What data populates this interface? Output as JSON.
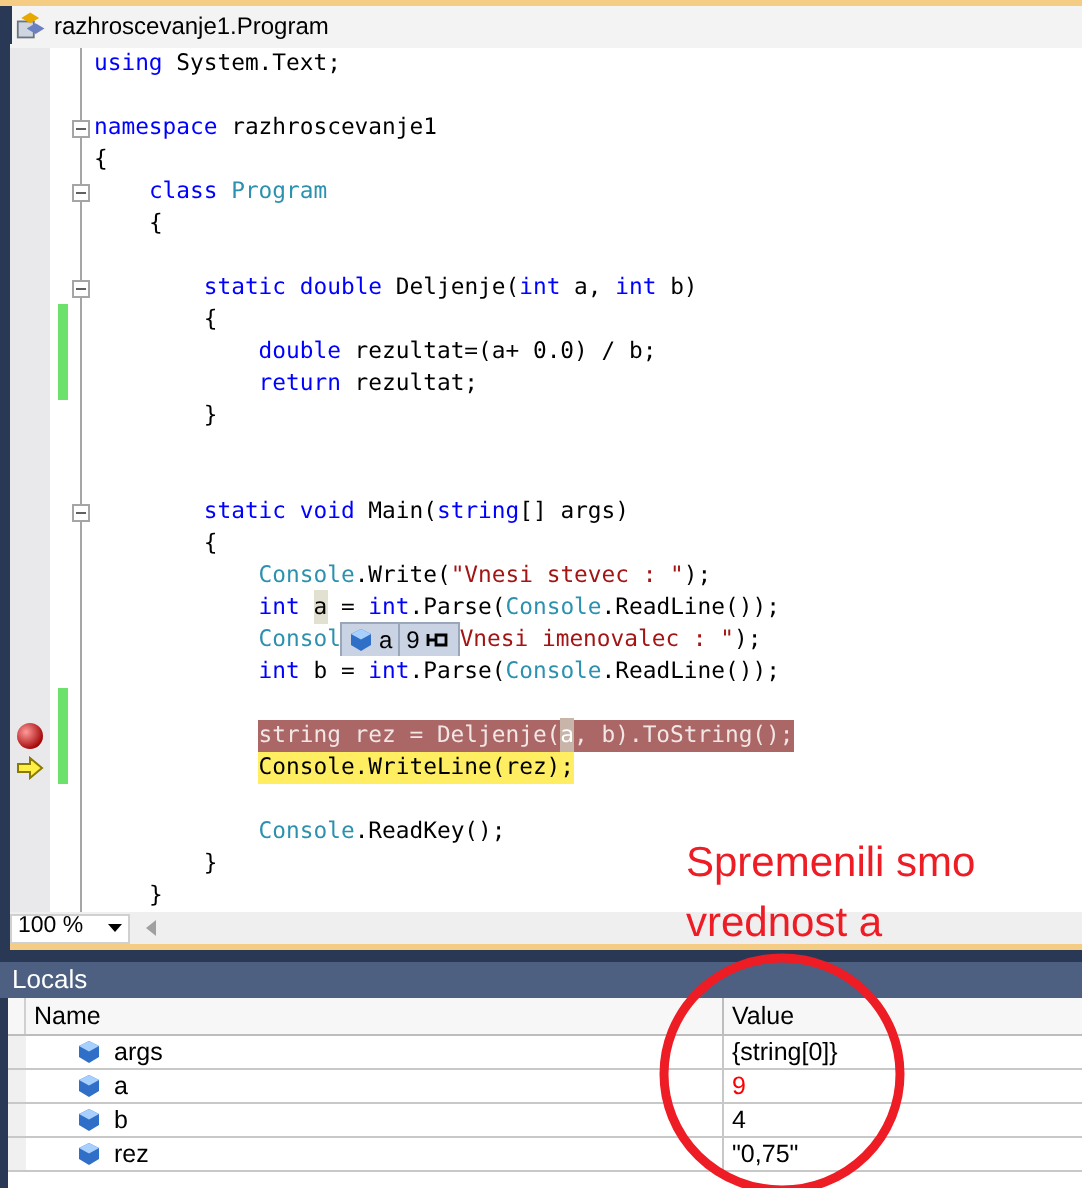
{
  "document_tab": {
    "title": "razhroscevanje1.Program"
  },
  "code_lines": [
    {
      "tokens": [
        {
          "text": "using",
          "kind": "keyword"
        },
        {
          "text": " System.Text;",
          "kind": "plain"
        }
      ],
      "fold": false,
      "modified": false,
      "breakpoint": false,
      "current": false
    },
    {
      "fold": false,
      "modified": false,
      "breakpoint": false,
      "current": false
    },
    {
      "tokens": [
        {
          "text": "namespace",
          "kind": "keyword"
        },
        {
          "text": " razhroscevanje1",
          "kind": "plain"
        }
      ],
      "fold": true,
      "modified": false,
      "breakpoint": false,
      "current": false
    },
    {
      "tokens": [
        {
          "text": "{",
          "kind": "plain"
        }
      ],
      "fold": false,
      "modified": false,
      "breakpoint": false,
      "current": false
    },
    {
      "tokens": [
        {
          "text": "    class",
          "kind": "keyword"
        },
        {
          "text": " Program",
          "kind": "type"
        }
      ],
      "fold": true,
      "modified": false,
      "breakpoint": false,
      "current": false
    },
    {
      "tokens": [
        {
          "text": "    {",
          "kind": "plain"
        }
      ],
      "fold": false,
      "modified": false,
      "breakpoint": false,
      "current": false
    },
    {
      "fold": false,
      "modified": false,
      "breakpoint": false,
      "current": false
    },
    {
      "tokens": [
        {
          "text": "        static",
          "kind": "keyword"
        },
        {
          "text": " double",
          "kind": "keyword"
        },
        {
          "text": " Deljenje(",
          "kind": "plain"
        },
        {
          "text": "int",
          "kind": "keyword"
        },
        {
          "text": " a, ",
          "kind": "plain"
        },
        {
          "text": "int",
          "kind": "keyword"
        },
        {
          "text": " b)",
          "kind": "plain"
        }
      ],
      "fold": true,
      "modified": false,
      "breakpoint": false,
      "current": false
    },
    {
      "tokens": [
        {
          "text": "        {",
          "kind": "plain"
        }
      ],
      "fold": false,
      "modified": true,
      "breakpoint": false,
      "current": false
    },
    {
      "tokens": [
        {
          "text": "            double",
          "kind": "keyword"
        },
        {
          "text": " rezultat=(a+ 0.0) / b;",
          "kind": "plain"
        }
      ],
      "fold": false,
      "modified": true,
      "breakpoint": false,
      "current": false
    },
    {
      "tokens": [
        {
          "text": "            return",
          "kind": "keyword"
        },
        {
          "text": " rezultat;",
          "kind": "plain"
        }
      ],
      "fold": false,
      "modified": true,
      "breakpoint": false,
      "current": false
    },
    {
      "tokens": [
        {
          "text": "        }",
          "kind": "plain"
        }
      ],
      "fold": false,
      "modified": false,
      "breakpoint": false,
      "current": false
    },
    {
      "fold": false,
      "modified": false,
      "breakpoint": false,
      "current": false
    },
    {
      "fold": false,
      "modified": false,
      "breakpoint": false,
      "current": false
    },
    {
      "tokens": [
        {
          "text": "        static",
          "kind": "keyword"
        },
        {
          "text": " void",
          "kind": "keyword"
        },
        {
          "text": " Main(",
          "kind": "plain"
        },
        {
          "text": "string",
          "kind": "keyword"
        },
        {
          "text": "[] args)",
          "kind": "plain"
        }
      ],
      "fold": true,
      "modified": false,
      "breakpoint": false,
      "current": false
    },
    {
      "tokens": [
        {
          "text": "        {",
          "kind": "plain"
        }
      ],
      "fold": false,
      "modified": false,
      "breakpoint": false,
      "current": false
    },
    {
      "tokens": [
        {
          "text": "            Console",
          "kind": "type"
        },
        {
          "text": ".Write(",
          "kind": "plain"
        },
        {
          "text": "\"Vnesi stevec : \"",
          "kind": "string"
        },
        {
          "text": ");",
          "kind": "plain"
        }
      ],
      "fold": false,
      "modified": false,
      "breakpoint": false,
      "current": false
    },
    {
      "tokens": [
        {
          "text": "            int ",
          "kind": "keyword"
        },
        {
          "text": "a",
          "kind": "highlight"
        },
        {
          "text": " = ",
          "kind": "plain"
        },
        {
          "text": "int",
          "kind": "keyword"
        },
        {
          "text": ".Parse(",
          "kind": "plain"
        },
        {
          "text": "Console",
          "kind": "type"
        },
        {
          "text": ".ReadLine());",
          "kind": "plain"
        }
      ],
      "fold": false,
      "modified": false,
      "breakpoint": false,
      "current": false
    },
    {
      "tokens": [
        {
          "text": "            Consol",
          "kind": "type"
        },
        {
          "kind": "datatip"
        },
        {
          "text": "Vnesi imenovalec : \"",
          "kind": "string"
        },
        {
          "text": ");",
          "kind": "plain"
        }
      ],
      "fold": false,
      "modified": false,
      "breakpoint": false,
      "current": false
    },
    {
      "tokens": [
        {
          "text": "            int",
          "kind": "keyword"
        },
        {
          "text": " b = ",
          "kind": "plain"
        },
        {
          "text": "int",
          "kind": "keyword"
        },
        {
          "text": ".Parse(",
          "kind": "plain"
        },
        {
          "text": "Console",
          "kind": "type"
        },
        {
          "text": ".ReadLine());",
          "kind": "plain"
        }
      ],
      "fold": false,
      "modified": false,
      "breakpoint": false,
      "current": false
    },
    {
      "fold": false,
      "modified": true,
      "breakpoint": false,
      "current": false
    },
    {
      "tokens": [
        {
          "text": "            string rez = Deljenje(",
          "kind": "plain"
        },
        {
          "text": "a",
          "kind": "highlight"
        },
        {
          "text": ", b).ToString();",
          "kind": "plain"
        }
      ],
      "fold": false,
      "modified": true,
      "breakpoint": true,
      "current": false
    },
    {
      "tokens": [
        {
          "text": "            Console.WriteLine(rez);",
          "kind": "plain"
        }
      ],
      "fold": false,
      "modified": true,
      "breakpoint": false,
      "current": true
    },
    {
      "fold": false,
      "modified": false,
      "breakpoint": false,
      "current": false
    },
    {
      "tokens": [
        {
          "text": "            Console",
          "kind": "type"
        },
        {
          "text": ".ReadKey();",
          "kind": "plain"
        }
      ],
      "fold": false,
      "modified": false,
      "breakpoint": false,
      "current": false
    },
    {
      "tokens": [
        {
          "text": "        }",
          "kind": "plain"
        }
      ],
      "fold": false,
      "modified": false,
      "breakpoint": false,
      "current": false
    },
    {
      "tokens": [
        {
          "text": "    }",
          "kind": "plain"
        }
      ],
      "fold": false,
      "modified": false,
      "breakpoint": false,
      "current": false
    }
  ],
  "datatip": {
    "name": "a",
    "value": "9"
  },
  "zoom": {
    "value": "100 %"
  },
  "annotation": {
    "lines": [
      "Spremenili smo",
      "vrednost a"
    ]
  },
  "locals": {
    "title": "Locals",
    "columns": [
      "Name",
      "Value"
    ],
    "rows": [
      {
        "name": "args",
        "value": "{string[0]}",
        "changed": false
      },
      {
        "name": "a",
        "value": "9",
        "changed": true
      },
      {
        "name": "b",
        "value": "4",
        "changed": false
      },
      {
        "name": "rez",
        "value": "\"0,75\"",
        "changed": false
      }
    ]
  }
}
